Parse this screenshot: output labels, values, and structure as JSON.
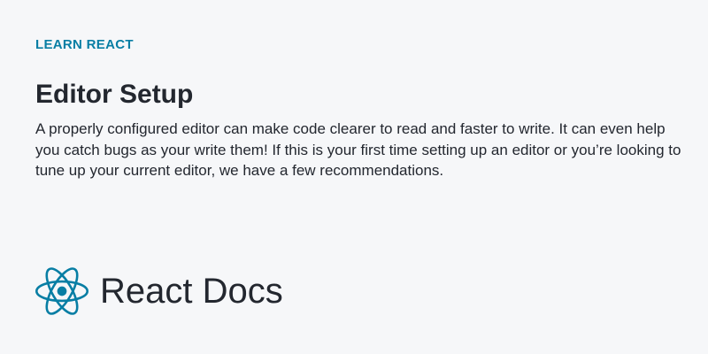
{
  "page": {
    "eyebrow": "LEARN REACT",
    "title": "Editor Setup",
    "description": "A properly configured editor can make code clearer to read and faster to write. It can even help you catch bugs as your write them! If this is your first time setting up an editor or you’re looking to tune up your current editor, we have a few recommendations."
  },
  "brand": {
    "name": "React Docs",
    "icon": "react-logo-icon"
  },
  "colors": {
    "accent": "#087ea4",
    "text": "#23272f",
    "background": "#f6f7f9"
  }
}
